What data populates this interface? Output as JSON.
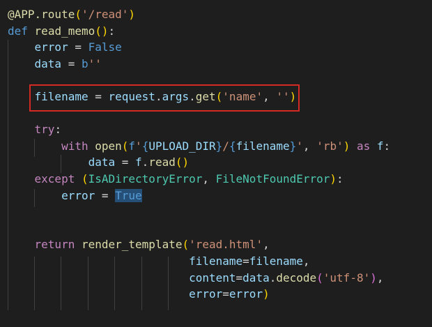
{
  "editor": {
    "theme": {
      "background": "#1e1e1e",
      "highlight_border": "#d52a24",
      "selection": "#264f78"
    },
    "lines": [
      [
        {
          "t": "@APP.route",
          "c": "dec"
        },
        {
          "t": "(",
          "c": "p1"
        },
        {
          "t": "'/read'",
          "c": "str"
        },
        {
          "t": ")",
          "c": "p1"
        }
      ],
      [
        {
          "t": "def",
          "c": "kw"
        },
        {
          "t": " ",
          "c": "op"
        },
        {
          "t": "read_memo",
          "c": "fn"
        },
        {
          "t": "()",
          "c": "p1"
        },
        {
          "t": ":",
          "c": "op"
        }
      ],
      [
        {
          "t": "    ",
          "c": "op"
        },
        {
          "t": "error",
          "c": "var"
        },
        {
          "t": " = ",
          "c": "op"
        },
        {
          "t": "False",
          "c": "kw"
        }
      ],
      [
        {
          "t": "    ",
          "c": "op"
        },
        {
          "t": "data",
          "c": "var"
        },
        {
          "t": " = ",
          "c": "op"
        },
        {
          "t": "b",
          "c": "kw"
        },
        {
          "t": "''",
          "c": "str"
        }
      ],
      [],
      [
        {
          "t": "    ",
          "c": "op"
        },
        {
          "t": "filename",
          "c": "var"
        },
        {
          "t": " = ",
          "c": "op"
        },
        {
          "t": "request",
          "c": "var"
        },
        {
          "t": ".",
          "c": "op"
        },
        {
          "t": "args",
          "c": "var"
        },
        {
          "t": ".",
          "c": "op"
        },
        {
          "t": "get",
          "c": "fn"
        },
        {
          "t": "(",
          "c": "p1"
        },
        {
          "t": "'name'",
          "c": "str"
        },
        {
          "t": ", ",
          "c": "op"
        },
        {
          "t": "''",
          "c": "str"
        },
        {
          "t": ")",
          "c": "p1"
        }
      ],
      [],
      [
        {
          "t": "    ",
          "c": "op"
        },
        {
          "t": "try",
          "c": "ctl"
        },
        {
          "t": ":",
          "c": "op"
        }
      ],
      [
        {
          "t": "        ",
          "c": "op"
        },
        {
          "t": "with",
          "c": "ctl"
        },
        {
          "t": " ",
          "c": "op"
        },
        {
          "t": "open",
          "c": "fn"
        },
        {
          "t": "(",
          "c": "p1"
        },
        {
          "t": "f",
          "c": "kw"
        },
        {
          "t": "'",
          "c": "str"
        },
        {
          "t": "{",
          "c": "kw"
        },
        {
          "t": "UPLOAD_DIR",
          "c": "var"
        },
        {
          "t": "}",
          "c": "kw"
        },
        {
          "t": "/",
          "c": "str"
        },
        {
          "t": "{",
          "c": "kw"
        },
        {
          "t": "filename",
          "c": "var"
        },
        {
          "t": "}",
          "c": "kw"
        },
        {
          "t": "'",
          "c": "str"
        },
        {
          "t": ", ",
          "c": "op"
        },
        {
          "t": "'rb'",
          "c": "str"
        },
        {
          "t": ")",
          "c": "p1"
        },
        {
          "t": " ",
          "c": "op"
        },
        {
          "t": "as",
          "c": "ctl"
        },
        {
          "t": " ",
          "c": "op"
        },
        {
          "t": "f",
          "c": "var"
        },
        {
          "t": ":",
          "c": "op"
        }
      ],
      [
        {
          "t": "            ",
          "c": "op"
        },
        {
          "t": "data",
          "c": "var"
        },
        {
          "t": " = ",
          "c": "op"
        },
        {
          "t": "f",
          "c": "var"
        },
        {
          "t": ".",
          "c": "op"
        },
        {
          "t": "read",
          "c": "fn"
        },
        {
          "t": "()",
          "c": "p1"
        }
      ],
      [
        {
          "t": "    ",
          "c": "op"
        },
        {
          "t": "except",
          "c": "ctl"
        },
        {
          "t": " ",
          "c": "op"
        },
        {
          "t": "(",
          "c": "p1"
        },
        {
          "t": "IsADirectoryError",
          "c": "cls"
        },
        {
          "t": ", ",
          "c": "op"
        },
        {
          "t": "FileNotFoundError",
          "c": "cls"
        },
        {
          "t": ")",
          "c": "p1"
        },
        {
          "t": ":",
          "c": "op"
        }
      ],
      [
        {
          "t": "        ",
          "c": "op"
        },
        {
          "t": "error",
          "c": "var"
        },
        {
          "t": " = ",
          "c": "op"
        },
        {
          "t": "True",
          "c": "kw",
          "sel": true
        }
      ],
      [],
      [],
      [
        {
          "t": "    ",
          "c": "op"
        },
        {
          "t": "return",
          "c": "ctl"
        },
        {
          "t": " ",
          "c": "op"
        },
        {
          "t": "render_template",
          "c": "fn"
        },
        {
          "t": "(",
          "c": "p1"
        },
        {
          "t": "'read.html'",
          "c": "str"
        },
        {
          "t": ",",
          "c": "op"
        }
      ],
      [
        {
          "t": "                           ",
          "c": "op"
        },
        {
          "t": "filename",
          "c": "var"
        },
        {
          "t": "=",
          "c": "op"
        },
        {
          "t": "filename",
          "c": "var"
        },
        {
          "t": ",",
          "c": "op"
        }
      ],
      [
        {
          "t": "                           ",
          "c": "op"
        },
        {
          "t": "content",
          "c": "var"
        },
        {
          "t": "=",
          "c": "op"
        },
        {
          "t": "data",
          "c": "var"
        },
        {
          "t": ".",
          "c": "op"
        },
        {
          "t": "decode",
          "c": "fn"
        },
        {
          "t": "(",
          "c": "p2"
        },
        {
          "t": "'utf-8'",
          "c": "str"
        },
        {
          "t": ")",
          "c": "p2"
        },
        {
          "t": ",",
          "c": "op"
        }
      ],
      [
        {
          "t": "                           ",
          "c": "op"
        },
        {
          "t": "error",
          "c": "var"
        },
        {
          "t": "=",
          "c": "op"
        },
        {
          "t": "error",
          "c": "var"
        },
        {
          "t": ")",
          "c": "p1"
        }
      ]
    ]
  }
}
